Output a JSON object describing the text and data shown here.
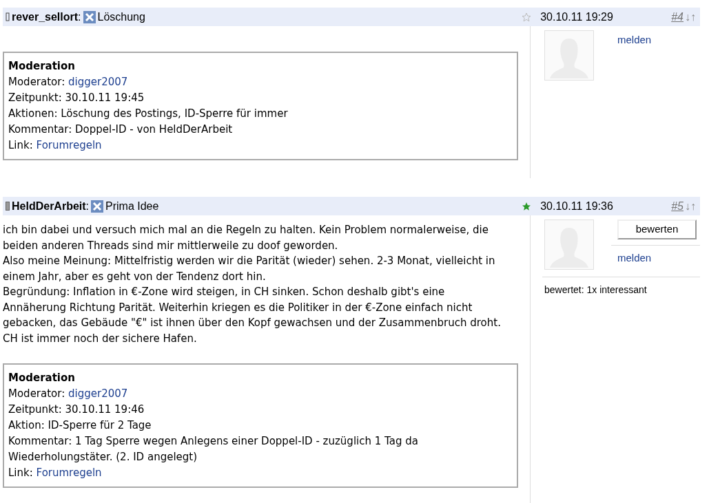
{
  "posts": [
    {
      "user": "rever_sellort",
      "user_online": false,
      "separator": ":",
      "title": "Löschung",
      "starred": false,
      "time": "30.10.11 19:29",
      "number": "#4",
      "arrow_down": "↓",
      "arrow_up": "↑",
      "moderation": {
        "heading": "Moderation",
        "rows": [
          {
            "label": "Moderator:",
            "value": "digger2007",
            "kind": "link"
          },
          {
            "label": "Zeitpunkt:",
            "value": "30.10.11 19:45",
            "kind": "text"
          },
          {
            "label": "Aktionen:",
            "value": "Löschung des Postings, ID-Sperre für immer",
            "kind": "text"
          },
          {
            "label": "Kommentar:",
            "value": "Doppel-ID - von HeldDerArbeit",
            "kind": "text"
          },
          {
            "label": "Link:",
            "value": "Forumregeln",
            "kind": "link"
          }
        ]
      },
      "side": {
        "report_link": "melden"
      }
    },
    {
      "user": "HeldDerArbeit",
      "user_online": true,
      "separator": ":",
      "title": "Prima Idee",
      "starred": true,
      "time": "30.10.11 19:36",
      "number": "#5",
      "arrow_down": "↓",
      "arrow_up": "↑",
      "body": [
        "ich bin dabei und versuch mich mal an die Regeln zu halten. Kein Problem normalerweise, die beiden anderen Threads sind mir mittlerweile zu doof geworden.",
        "Also meine Meinung: Mittelfristig werden wir die Parität (wieder) sehen. 2-3 Monat, vielleicht in einem Jahr, aber es geht von der Tendenz dort hin.",
        "Begründung: Inflation in €-Zone wird steigen, in CH sinken. Schon deshalb gibt's eine Annäherung Richtung Parität. Weiterhin kriegen es die Politiker in der €-Zone einfach nicht gebacken, das Gebäude \"€\" ist ihnen über den Kopf gewachsen und der Zusammenbruch droht. CH ist immer noch der sichere Hafen."
      ],
      "moderation": {
        "heading": "Moderation",
        "rows": [
          {
            "label": "Moderator:",
            "value": "digger2007",
            "kind": "link"
          },
          {
            "label": "Zeitpunkt:",
            "value": "30.10.11 19:46",
            "kind": "text"
          },
          {
            "label": "Aktion:",
            "value": "ID-Sperre für 2 Tage",
            "kind": "text"
          },
          {
            "label": "Kommentar:",
            "value": "1 Tag Sperre wegen Anlegens einer Doppel-ID - zuzüglich 1 Tag da Wiederholungstäter. (2. ID angelegt)",
            "kind": "text"
          },
          {
            "label": "Link:",
            "value": "Forumregeln",
            "kind": "link"
          }
        ]
      },
      "side": {
        "rate_button": "bewerten",
        "report_link": "melden",
        "rating": "bewertet: 1x interessant"
      }
    }
  ]
}
